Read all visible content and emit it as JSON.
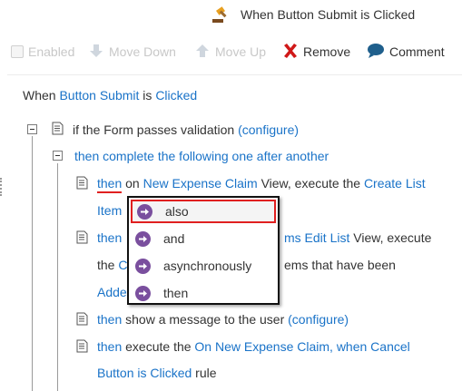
{
  "header": {
    "title": "When Button Submit is Clicked",
    "icon": "gavel-icon"
  },
  "toolbar": {
    "enabled": "Enabled",
    "move_down": "Move Down",
    "move_up": "Move Up",
    "remove": "Remove",
    "comment": "Comment"
  },
  "rule": {
    "when_prefix": "When",
    "when_control": "Button Submit",
    "when_is": "is",
    "when_event": "Clicked",
    "cond_text": "if the Form passes validation",
    "cond_link": "(configure)",
    "then_complete": "then complete the following one after another",
    "a1_then": "then",
    "a1_on": "on",
    "a1_view": "New Expense Claim",
    "a1_mid": "View, execute the",
    "a1_method_1": "Create List",
    "a1_method_2": "Item",
    "a2_then": "then",
    "a2_link_tail": "ms Edit List",
    "a2_mid": "View, execute",
    "a2_the": "the",
    "a2_c": "C",
    "a2_tail": "ems that have been",
    "a2_added": "Adde",
    "a3_then": "then",
    "a3_text": "show a message to the user",
    "a3_link": "(configure)",
    "a4_then": "then",
    "a4_text": "execute the",
    "a4_link_1": "On New Expense Claim, when Cancel",
    "a4_link_2": "Button is Clicked",
    "a4_rule": "rule"
  },
  "popup": {
    "items": [
      "also",
      "and",
      "asynchronously",
      "then"
    ],
    "selected": "also"
  },
  "colors": {
    "link": "#1a73c8",
    "popup_icon": "#7a4f9e",
    "highlight": "#e02020"
  }
}
